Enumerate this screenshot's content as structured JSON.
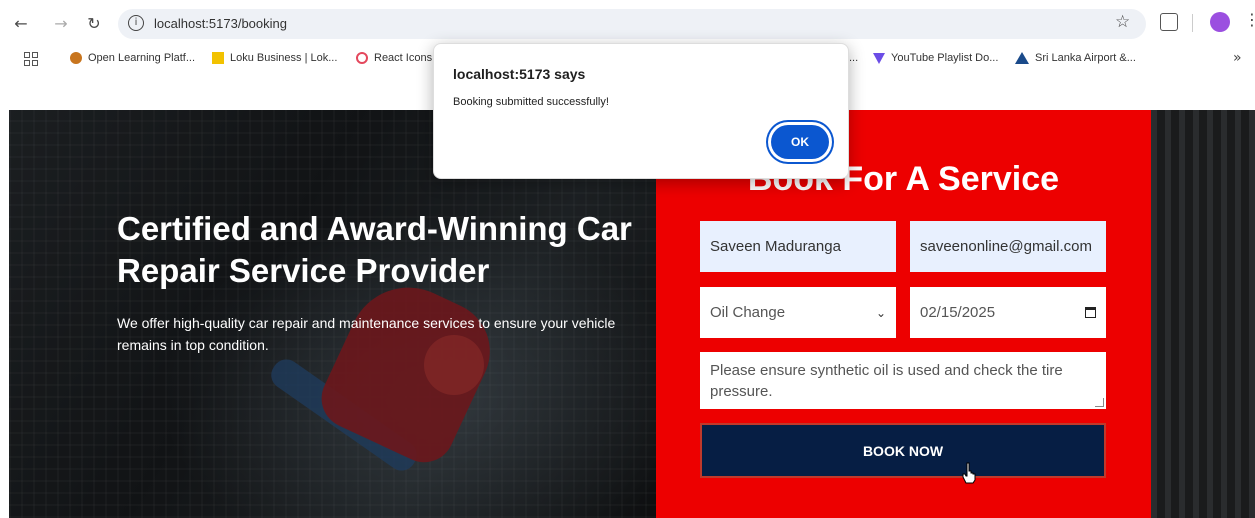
{
  "browser": {
    "url": "localhost:5173/booking",
    "bookmarks": [
      {
        "label": "Open Learning Platf...",
        "icon": "open-learning-icon"
      },
      {
        "label": "Loku Business | Lok...",
        "icon": "loku-icon"
      },
      {
        "label": "React Icons",
        "icon": "react-icon"
      },
      {
        "label": "...",
        "icon": "none"
      },
      {
        "label": "YouTube Playlist Do...",
        "icon": "youtube-playlist-icon"
      },
      {
        "label": "Sri Lanka Airport &...",
        "icon": "airport-icon"
      }
    ],
    "more_label": "»"
  },
  "hero": {
    "title": "Certified and Award-Winning Car Repair Service Provider",
    "subtitle": "We offer high-quality car repair and maintenance services to ensure your vehicle remains in top condition."
  },
  "booking": {
    "title": "Book For A Service",
    "name_value": "Saveen Maduranga",
    "email_value": "saveenonline@gmail.com",
    "service_value": "Oil Change",
    "date_value": "02/15/2025",
    "notes_value": "Please ensure synthetic oil is used and check the tire pressure.",
    "button_label": "BOOK NOW",
    "accent_color": "#ed0000",
    "button_color": "#061e44"
  },
  "dialog": {
    "title": "localhost:5173 says",
    "message": "Booking submitted successfully!",
    "ok_label": "OK"
  }
}
